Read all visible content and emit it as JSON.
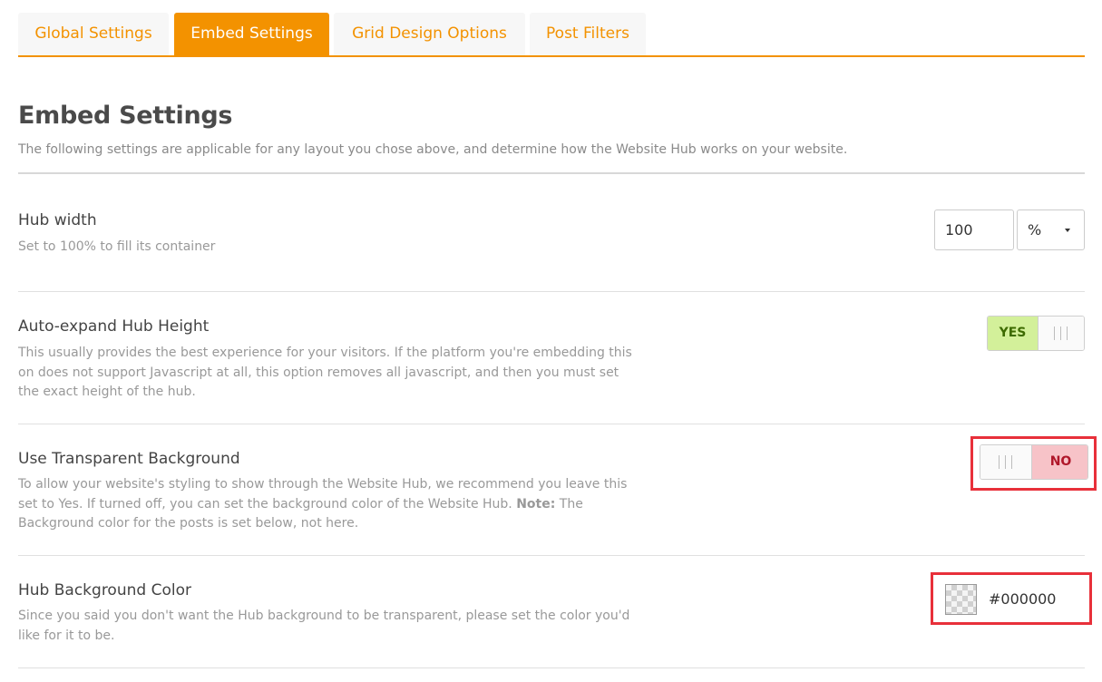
{
  "tabs": [
    {
      "label": "Global Settings",
      "active": false
    },
    {
      "label": "Embed Settings",
      "active": true
    },
    {
      "label": "Grid Design Options",
      "active": false
    },
    {
      "label": "Post Filters",
      "active": false
    }
  ],
  "page": {
    "title": "Embed Settings",
    "description": "The following settings are applicable for any layout you chose above, and determine how the Website Hub works on your website."
  },
  "settings": {
    "hub_width": {
      "title": "Hub width",
      "description": "Set to 100% to fill its container",
      "value": "100",
      "unit": "%"
    },
    "auto_expand": {
      "title": "Auto-expand Hub Height",
      "description": "This usually provides the best experience for your visitors. If the platform you're embedding this on does not support Javascript at all, this option removes all javascript, and then you must set the exact height of the hub.",
      "state": "YES"
    },
    "transparent_bg": {
      "title": "Use Transparent Background",
      "description_pre": "To allow your website's styling to show through the Website Hub, we recommend you leave this set to Yes. If turned off, you can set the background color of the Website Hub.",
      "note_label": "Note:",
      "description_post": "The Background color for the posts is set below, not here.",
      "state": "NO"
    },
    "bg_color": {
      "title": "Hub Background Color",
      "description": "Since you said you don't want the Hub background to be transparent, please set the color you'd like for it to be.",
      "value": "#000000"
    }
  },
  "colors": {
    "accent": "#f39200",
    "yes_bg": "#d3f09a",
    "no_bg": "#f7c3c8",
    "highlight": "#e8303a"
  }
}
